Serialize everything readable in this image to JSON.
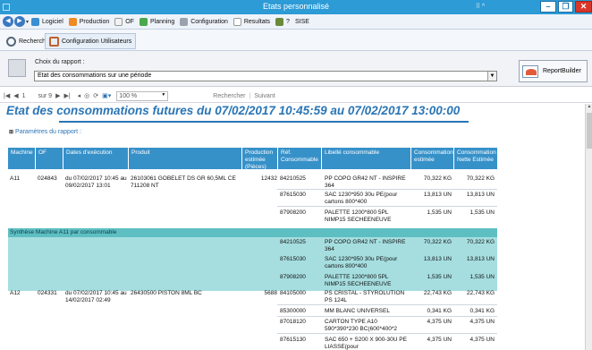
{
  "window": {
    "title": "Etats personnalisé",
    "caption_buttons": [
      "–",
      "❐",
      "✕"
    ]
  },
  "menu": {
    "items": [
      "Logiciel",
      "Production",
      "OF",
      "Planning",
      "Configuration",
      "Resultats",
      "SISE"
    ],
    "help": "?"
  },
  "tabs": [
    "Recherche",
    "Configuration Utilisateurs"
  ],
  "panel": {
    "choose_label": "Choix du rapport :",
    "selected_report": "Etat des consommations sur une période",
    "report_builder": "ReportBuilder"
  },
  "toolbar": {
    "page": "1",
    "of_label": "sur 9",
    "zoom": "100 %",
    "search": "Rechercher",
    "next": "Suivant"
  },
  "report": {
    "title": "Etat des consommations futures du 07/02/2017 10:45:59 au 07/02/2017 13:00:00",
    "params": "Paramètres du rapport :",
    "headers": [
      "Machine",
      "OF",
      "Dates d'exécution",
      "Produit",
      "Production estimée (Pièces)",
      "Réf. Consommable",
      "Libellé consommable",
      "Consommation estimée",
      "Consommation Nette Estimée"
    ],
    "synth_label": "Synthèse Machine A11 par consommable",
    "blocks": [
      {
        "machine": "A11",
        "of": "024843",
        "dates": "du 07/02/2017 10:45 au 09/02/2017 13:01",
        "product": "26103061 GOBELET DS GR 60,5ML CE 711208 NT",
        "production": "12432",
        "rows": [
          [
            "84210525",
            "PP COPO GR42 NT - INSPIRE 364",
            "70,322 KG",
            "70,322 KG"
          ],
          [
            "87615030",
            "SAC 1230*950 30u PE(pour cartons 800*400",
            "13,813 UN",
            "13,813 UN"
          ],
          [
            "87908200",
            "PALETTE 1200*800 5PL NIMP15 SECHEENEUVE",
            "1,535 UN",
            "1,535 UN"
          ]
        ]
      },
      {
        "machine": "",
        "of": "",
        "dates": "",
        "product": "",
        "production": "",
        "rows": [
          [
            "84210525",
            "PP COPO GR42 NT - INSPIRE 364",
            "70,322 KG",
            "70,322 KG"
          ],
          [
            "87615030",
            "SAC 1230*950 30u PE(pour cartons 800*400",
            "13,813 UN",
            "13,813 UN"
          ],
          [
            "87908200",
            "PALETTE 1200*800 5PL NIMP15 SECHEENEUVE",
            "1,535 UN",
            "1,535 UN"
          ]
        ]
      },
      {
        "machine": "A12",
        "of": "024331",
        "dates": "du 07/02/2017 10:45 au 14/02/2017 02:49",
        "product": "26430500 PISTON 8ML BC",
        "production": "5688",
        "rows": [
          [
            "84105000",
            "PS CRISTAL - STYROLUTION PS 124L",
            "22,743 KG",
            "22,743 KG"
          ],
          [
            "85300000",
            "MM BLANC UNIVERSEL",
            "0,341 KG",
            "0,341 KG"
          ],
          [
            "87018120",
            "CARTON TYPE A10 590*390*230 BC(600*400*2",
            "4,375 UN",
            "4,375 UN"
          ],
          [
            "87615130",
            "SAC 650 + S200 X 900-30U PE LIASSE(pour",
            "4,375 UN",
            "4,375 UN"
          ]
        ]
      }
    ]
  },
  "colors": {
    "titlebar": "#2c9bd6",
    "header": "#3791c9",
    "synth_header": "#5ebfc3",
    "synth_body": "#a6dee0",
    "title": "#2a75b5"
  }
}
